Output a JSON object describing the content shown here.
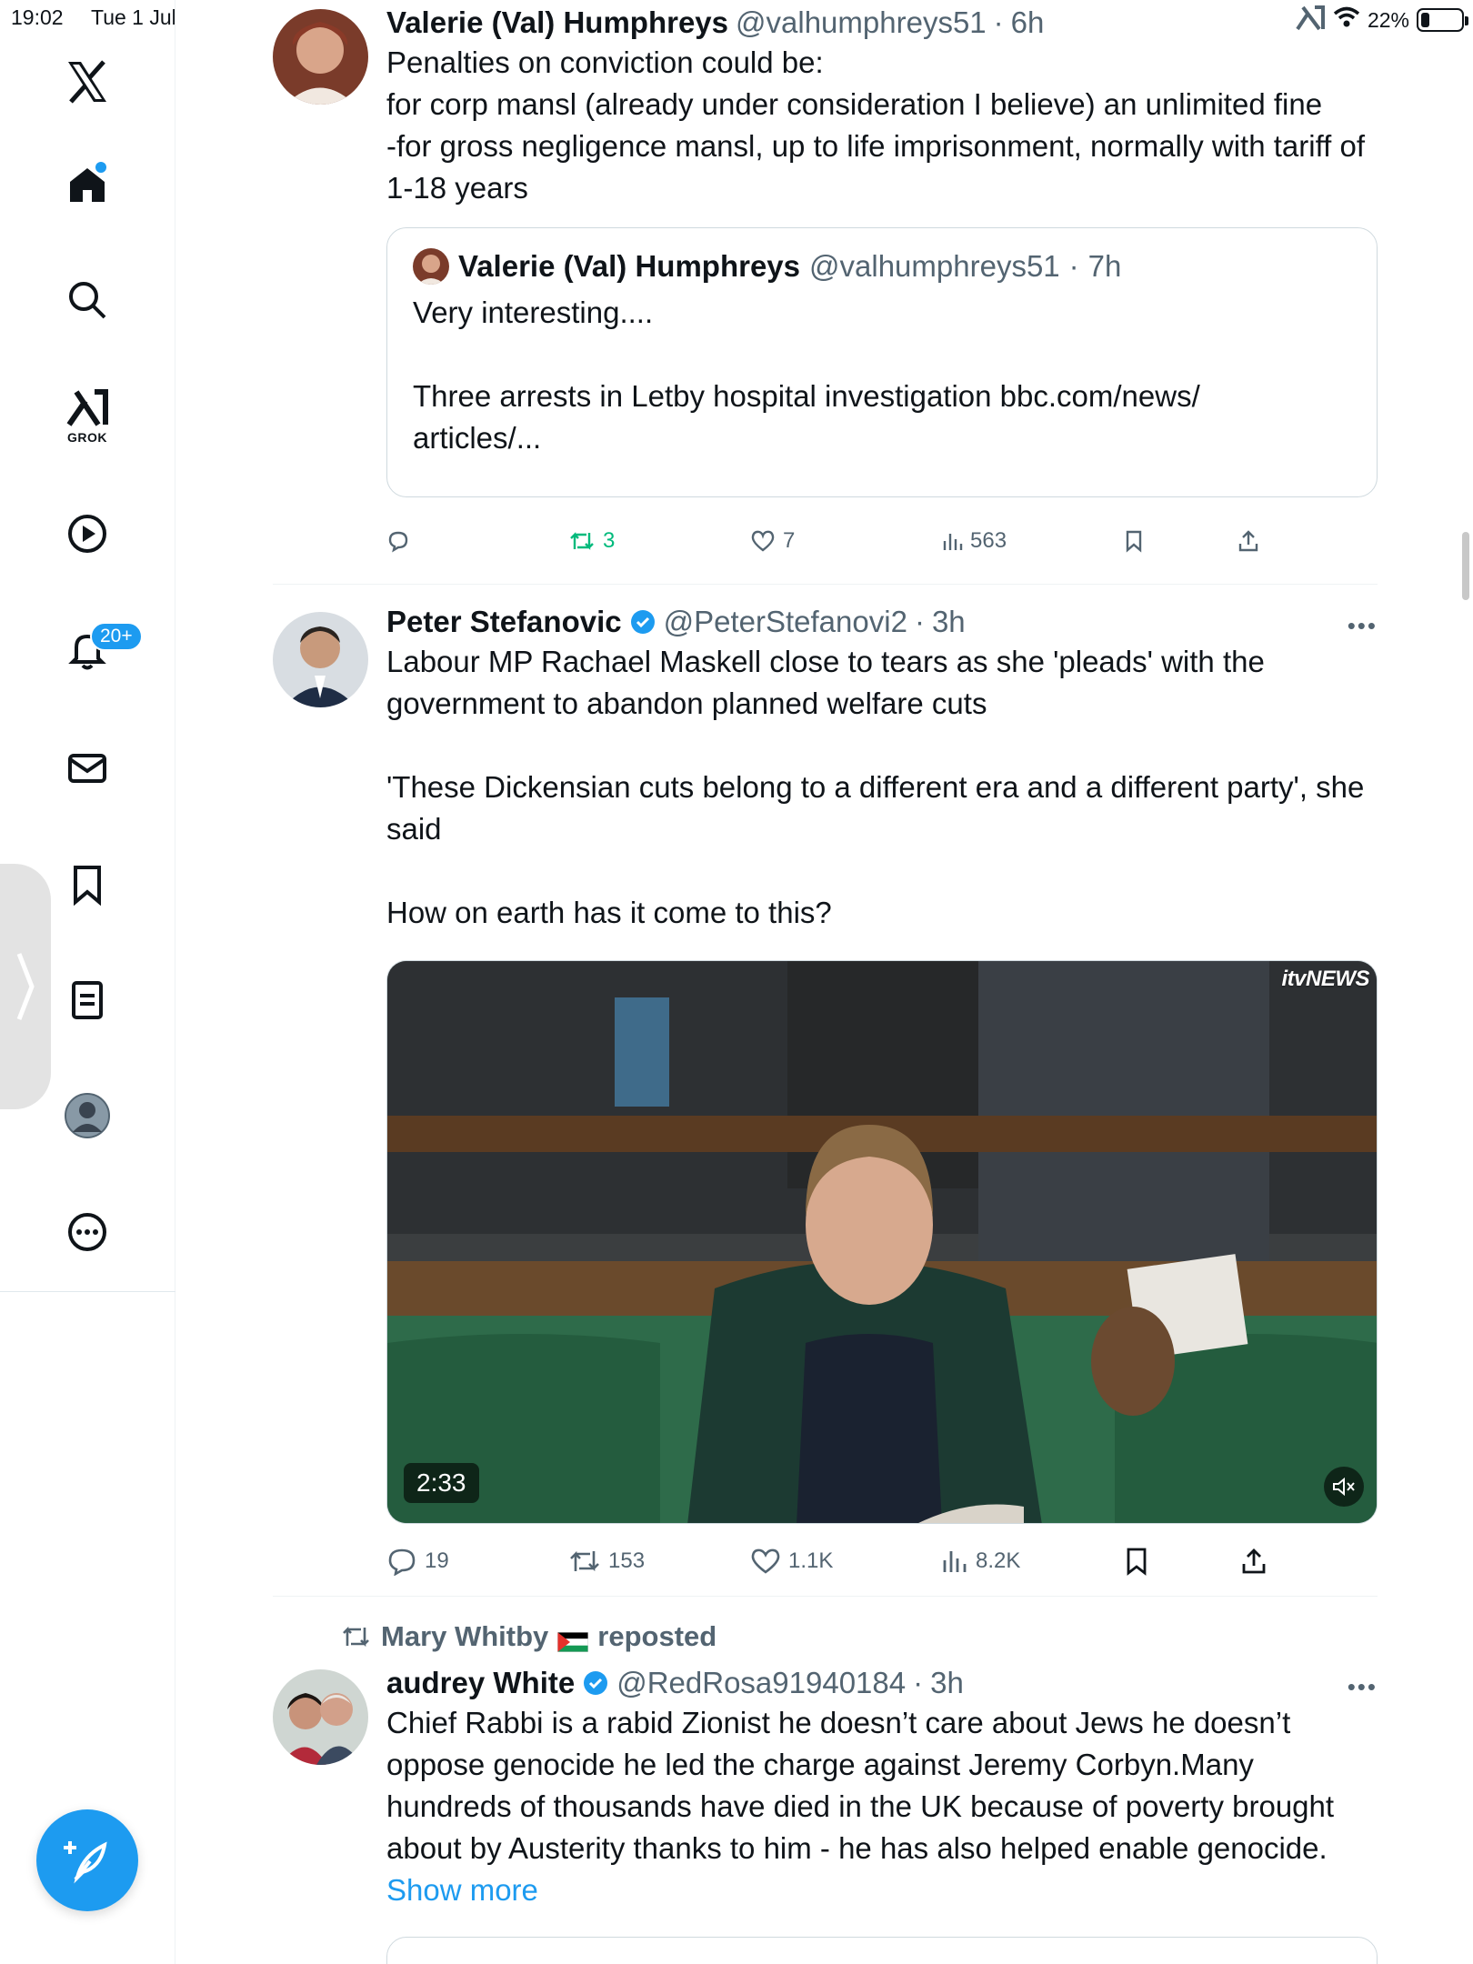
{
  "status_bar": {
    "time": "19:02",
    "date": "Tue 1 Jul",
    "battery": "22%",
    "battery_level": 0.22
  },
  "sidebar": {
    "grok_label": "GROK",
    "notifications_badge": "20+"
  },
  "tweets": [
    {
      "name": "Valerie (Val) Humphreys",
      "handle": "@valhumphreys51",
      "time": "6h",
      "text": "Penalties on conviction could be:\nfor corp mansl (already under consideration I believe) an unlimited fine\n-for gross negligence mansl, up to life imprisonment, normally with tariff of 1-18 years",
      "quote": {
        "name": "Valerie (Val) Humphreys",
        "handle": "@valhumphreys51",
        "time": "7h",
        "text": "Very interesting....\n\nThree arrests in Letby hospital investigation bbc.com/news/\narticles/..."
      },
      "stats": {
        "replies": "",
        "retweets": "3",
        "likes": "7",
        "views": "563"
      }
    },
    {
      "name": "Peter Stefanovic",
      "handle": "@PeterStefanovi2",
      "time": "3h",
      "text": "Labour MP Rachael Maskell close to tears as she 'pleads' with the government to abandon planned welfare cuts\n\n'These Dickensian cuts belong to a different era and a different party', she said\n\nHow on earth has it come to this?",
      "video": {
        "duration": "2:33",
        "watermark": "itvNEWS"
      },
      "stats": {
        "replies": "19",
        "retweets": "153",
        "likes": "1.1K",
        "views": "8.2K"
      }
    },
    {
      "reposted_by": "Mary Whitby",
      "reposted_label": "reposted",
      "name": "audrey White",
      "handle": "@RedRosa91940184",
      "time": "3h",
      "text": "Chief Rabbi is a rabid Zionist he doesn’t care about Jews he doesn’t oppose genocide he led the charge against Jeremy Corbyn.Many hundreds of thousands have died in the UK because of poverty brought about by Austerity thanks to him - he has also helped enable genocide. ",
      "show_more": "Show more"
    }
  ],
  "separator": "·"
}
